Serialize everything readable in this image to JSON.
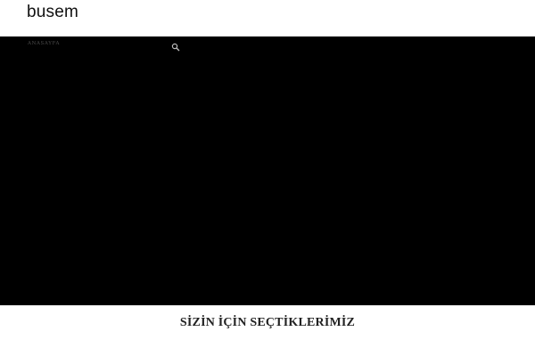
{
  "header": {
    "logo_text": "busem"
  },
  "nav": {
    "items": [
      {
        "label": "ANASAYFA"
      }
    ],
    "search_icon": "search-icon"
  },
  "section": {
    "title": "SİZİN İÇİN SEÇTİKLERİMİZ"
  },
  "colors": {
    "hero_background": "#000000",
    "page_background": "#ffffff",
    "nav_text": "#4a4a4a",
    "search_icon": "#bbbbbb"
  }
}
